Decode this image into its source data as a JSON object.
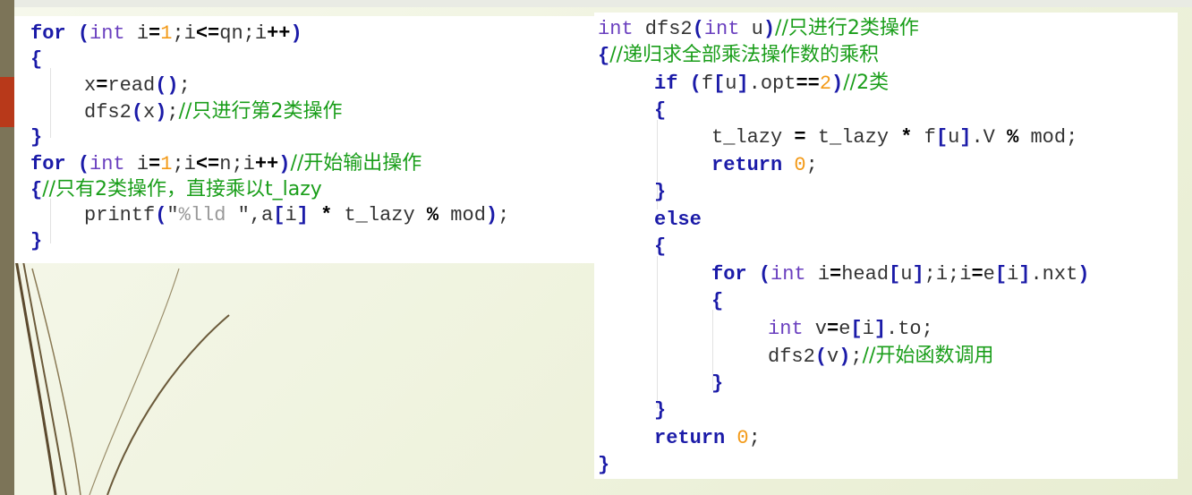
{
  "left_code": {
    "l1": {
      "kw": "for",
      "sp": " ",
      "b1": "(",
      "ty": "int",
      "t1": " i",
      "op1": "=",
      "num": "1",
      "t2": ";i",
      "op2": "<=",
      "t3": "qn;i",
      "op3": "++",
      "b2": ")"
    },
    "l2": {
      "b": "{"
    },
    "l3": {
      "t1": "x",
      "op": "=",
      "t2": "read",
      "b": "()",
      "t3": ";"
    },
    "l4": {
      "t1": "dfs2",
      "b1": "(",
      "t2": "x",
      "b2": ")",
      "t3": ";",
      "cm": "//只进行第2类操作"
    },
    "l5": {
      "b": "}"
    },
    "l6": {
      "kw": "for",
      "sp": " ",
      "b1": "(",
      "ty": "int",
      "t1": " i",
      "op1": "=",
      "num": "1",
      "t2": ";i",
      "op2": "<=",
      "t3": "n;i",
      "op3": "++",
      "b2": ")",
      "cm": "//开始输出操作"
    },
    "l7": {
      "b": "{",
      "cm": "//只有2类操作，直接乘以t_lazy"
    },
    "l8": {
      "t1": "printf",
      "b1": "(",
      "s1": "\"",
      "fmt": "%lld",
      "s2": " \"",
      "t2": ",a",
      "b2": "[",
      "t3": "i",
      "b3": "]",
      "sp": " ",
      "op": "*",
      "t4": " t_lazy ",
      "op2": "%",
      "t5": " mod",
      "b4": ")",
      "t6": ";"
    },
    "l9": {
      "b": "}"
    }
  },
  "right_code": {
    "r1": {
      "ty": "int",
      "t1": " dfs2",
      "b1": "(",
      "ty2": "int",
      "t2": " u",
      "b2": ")",
      "cm": "//只进行2类操作"
    },
    "r2": {
      "b": "{",
      "cm": "//递归求全部乘法操作数的乘积"
    },
    "r3": {
      "kw": "if",
      "sp": " ",
      "b1": "(",
      "t1": "f",
      "b2": "[",
      "t2": "u",
      "b3": "]",
      "t3": ".opt",
      "op": "==",
      "num": "2",
      "b4": ")",
      "cm": "//2类"
    },
    "r4": {
      "b": "{"
    },
    "r5": {
      "t1": "t_lazy ",
      "op1": "=",
      "t2": " t_lazy ",
      "op2": "*",
      "t3": " f",
      "b1": "[",
      "t4": "u",
      "b2": "]",
      "t5": ".V ",
      "op3": "%",
      "t6": " mod;"
    },
    "r6": {
      "kw": "return",
      "sp": " ",
      "num": "0",
      "t": ";"
    },
    "r7": {
      "b": "}"
    },
    "r8": {
      "kw": "else"
    },
    "r9": {
      "b": "{"
    },
    "r10": {
      "kw": "for",
      "sp": " ",
      "b1": "(",
      "ty": "int",
      "t1": " i",
      "op1": "=",
      "t2": "head",
      "b2": "[",
      "t3": "u",
      "b3": "]",
      "t4": ";i;i",
      "op2": "=",
      "t5": "e",
      "b4": "[",
      "t6": "i",
      "b5": "]",
      "t7": ".nxt",
      "b6": ")"
    },
    "r11": {
      "b": "{"
    },
    "r12": {
      "ty": "int",
      "t1": " v",
      "op": "=",
      "t2": "e",
      "b1": "[",
      "t3": "i",
      "b2": "]",
      "t4": ".to;"
    },
    "r13": {
      "t1": "dfs2",
      "b1": "(",
      "t2": "v",
      "b2": ")",
      "t3": ";",
      "cm": "//开始函数调用"
    },
    "r14": {
      "b": "}"
    },
    "r15": {
      "b": "}"
    },
    "r16": {
      "kw": "return",
      "sp": " ",
      "num": "0",
      "t": ";"
    },
    "r17": {
      "b": "}"
    }
  },
  "colors": {
    "keyword": "#1b1ba8",
    "type": "#6a3fbf",
    "number": "#f39a18",
    "comment": "#1a9e1a",
    "sidebar": "#7c7458",
    "accent": "#b8391a"
  }
}
